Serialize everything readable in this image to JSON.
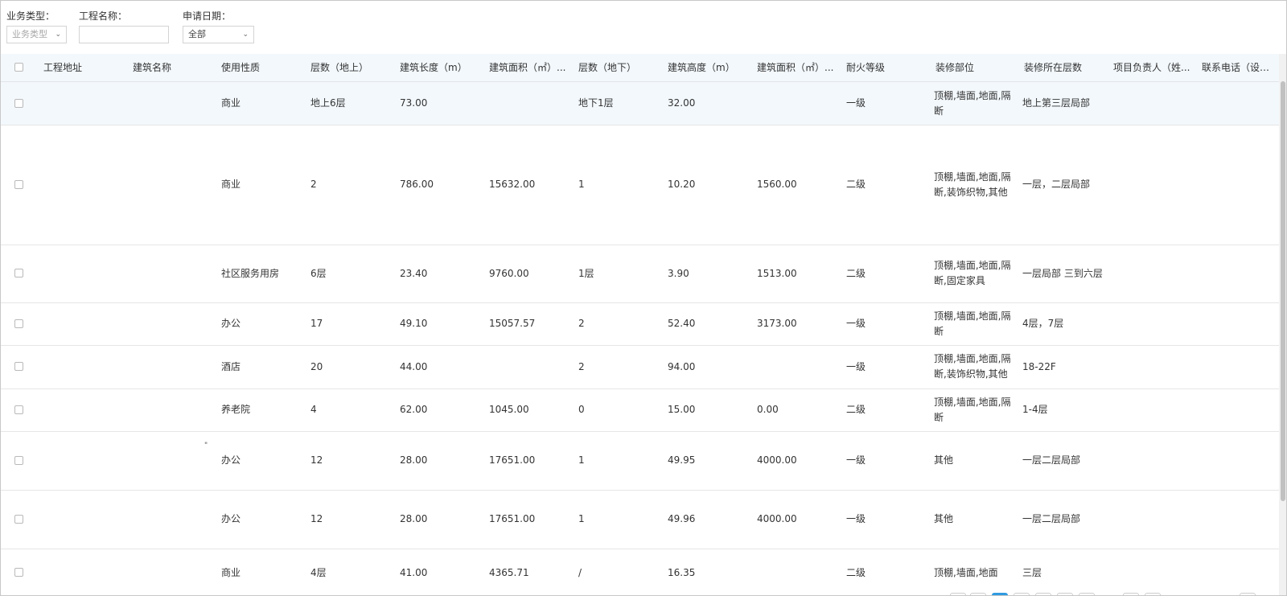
{
  "filters": {
    "business_type": {
      "label": "业务类型：",
      "placeholder": "业务类型"
    },
    "project_name": {
      "label": "工程名称：",
      "value": ""
    },
    "apply_date": {
      "label": "申请日期：",
      "value": "全部"
    }
  },
  "table": {
    "columns": [
      "工程地址",
      "建筑名称",
      "使用性质",
      "层数（地上）",
      "建筑长度（m）",
      "建筑面积（㎡）...",
      "层数（地下）",
      "建筑高度（m）",
      "建筑面积（㎡）...",
      "耐火等级",
      "装修部位",
      "装修所在层数",
      "项目负责人（姓...",
      "联系电话（设计..."
    ],
    "rows": [
      {
        "use": "商业",
        "floors_above": "地上6层",
        "length": "73.00",
        "area": "",
        "floors_below": "地下1层",
        "height": "32.00",
        "area2": "",
        "fire_grade": "一级",
        "deco_parts": "顶棚,墙面,地面,隔断",
        "deco_floors": "地上第三层局部"
      },
      {
        "use": "商业",
        "floors_above": "2",
        "length": "786.00",
        "area": "15632.00",
        "floors_below": "1",
        "height": "10.20",
        "area2": "1560.00",
        "fire_grade": "二级",
        "deco_parts": "顶棚,墙面,地面,隔断,装饰织物,其他",
        "deco_floors": "一层，二层局部"
      },
      {
        "use": "社区服务用房",
        "floors_above": "6层",
        "length": "23.40",
        "area": "9760.00",
        "floors_below": "1层",
        "height": "3.90",
        "area2": "1513.00",
        "fire_grade": "二级",
        "deco_parts": "顶棚,墙面,地面,隔断,固定家具",
        "deco_floors": "一层局部 三到六层"
      },
      {
        "use": "办公",
        "floors_above": "17",
        "length": "49.10",
        "area": "15057.57",
        "floors_below": "2",
        "height": "52.40",
        "area2": "3173.00",
        "fire_grade": "一级",
        "deco_parts": "顶棚,墙面,地面,隔断",
        "deco_floors": "4层，7层"
      },
      {
        "use": "酒店",
        "floors_above": "20",
        "length": "44.00",
        "area": "",
        "floors_below": "2",
        "height": "94.00",
        "area2": "",
        "fire_grade": "一级",
        "deco_parts": "顶棚,墙面,地面,隔断,装饰织物,其他",
        "deco_floors": "18-22F"
      },
      {
        "use": "养老院",
        "floors_above": "4",
        "length": "62.00",
        "area": "1045.00",
        "floors_below": "0",
        "height": "15.00",
        "area2": "0.00",
        "fire_grade": "二级",
        "deco_parts": "顶棚,墙面,地面,隔断",
        "deco_floors": "1-4层"
      },
      {
        "use": "办公",
        "floors_above": "12",
        "length": "28.00",
        "area": "17651.00",
        "floors_below": "1",
        "height": "49.95",
        "area2": "4000.00",
        "fire_grade": "一级",
        "deco_parts": "其他",
        "deco_floors": "一层二层局部"
      },
      {
        "use": "办公",
        "floors_above": "12",
        "length": "28.00",
        "area": "17651.00",
        "floors_below": "1",
        "height": "49.96",
        "area2": "4000.00",
        "fire_grade": "一级",
        "deco_parts": "其他",
        "deco_floors": "一层二层局部"
      },
      {
        "use": "商业",
        "floors_above": "4层",
        "length": "41.00",
        "area": "4365.71",
        "floors_below": "/",
        "height": "16.35",
        "area2": "",
        "fire_grade": "二级",
        "deco_parts": "顶棚,墙面,地面",
        "deco_floors": "三层"
      }
    ]
  },
  "stray_mark": "\"",
  "colors": {
    "header_bg": "#f3f8fc",
    "selected_row_bg": "#f3f8fc",
    "accent": "#2f9ae0"
  }
}
